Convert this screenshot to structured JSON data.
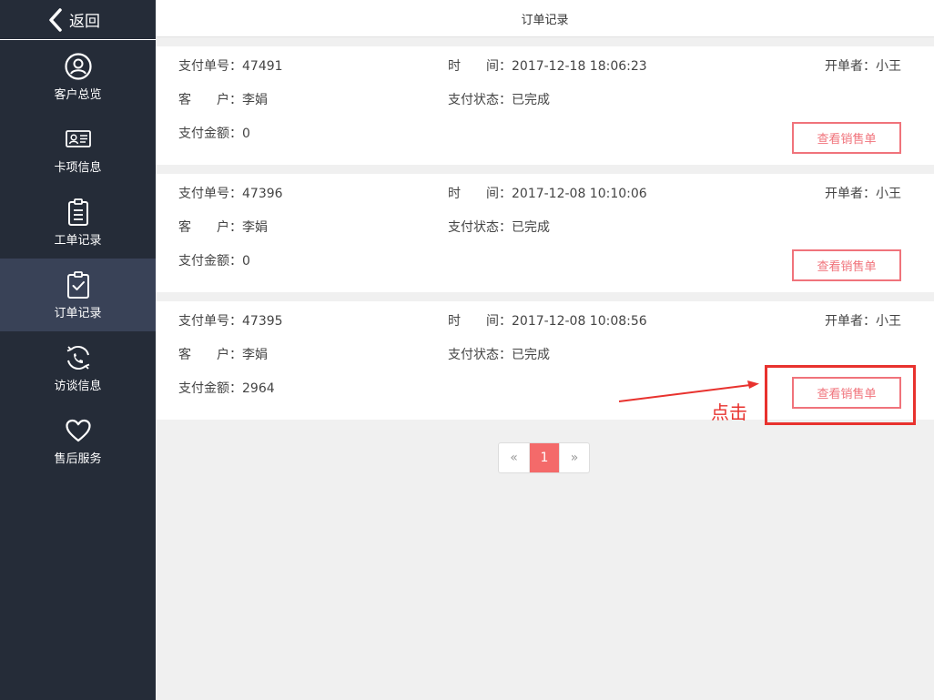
{
  "sidebar": {
    "back_label": "返回",
    "items": [
      {
        "label": "客户总览",
        "icon": "user-circle-icon"
      },
      {
        "label": "卡项信息",
        "icon": "id-card-icon"
      },
      {
        "label": "工单记录",
        "icon": "clipboard-icon"
      },
      {
        "label": "订单记录",
        "icon": "clipboard-check-icon"
      },
      {
        "label": "访谈信息",
        "icon": "phone-cycle-icon"
      },
      {
        "label": "售后服务",
        "icon": "heart-icon"
      }
    ],
    "active_index": 3
  },
  "header": {
    "title": "订单记录"
  },
  "orders": [
    {
      "pay_no": "支付单号：47491",
      "time": "时　　间：2017-12-18 18:06:23",
      "opener": "开单者：小王",
      "customer": "客　　户：李娟",
      "status": "支付状态：已完成",
      "amount": "支付金额：0",
      "button": "查看销售单"
    },
    {
      "pay_no": "支付单号：47396",
      "time": "时　　间：2017-12-08 10:10:06",
      "opener": "开单者：小王",
      "customer": "客　　户：李娟",
      "status": "支付状态：已完成",
      "amount": "支付金额：0",
      "button": "查看销售单"
    },
    {
      "pay_no": "支付单号：47395",
      "time": "时　　间：2017-12-08 10:08:56",
      "opener": "开单者：小王",
      "customer": "客　　户：李娟",
      "status": "支付状态：已完成",
      "amount": "支付金额：2964",
      "button": "查看销售单"
    }
  ],
  "pagination": {
    "prev": "«",
    "current": "1",
    "next": "»"
  },
  "annotation": {
    "text": "点击",
    "color": "#e8322e"
  },
  "colors": {
    "sidebar_bg": "#252c38",
    "active_bg": "#394257",
    "accent": "#f0737b"
  }
}
